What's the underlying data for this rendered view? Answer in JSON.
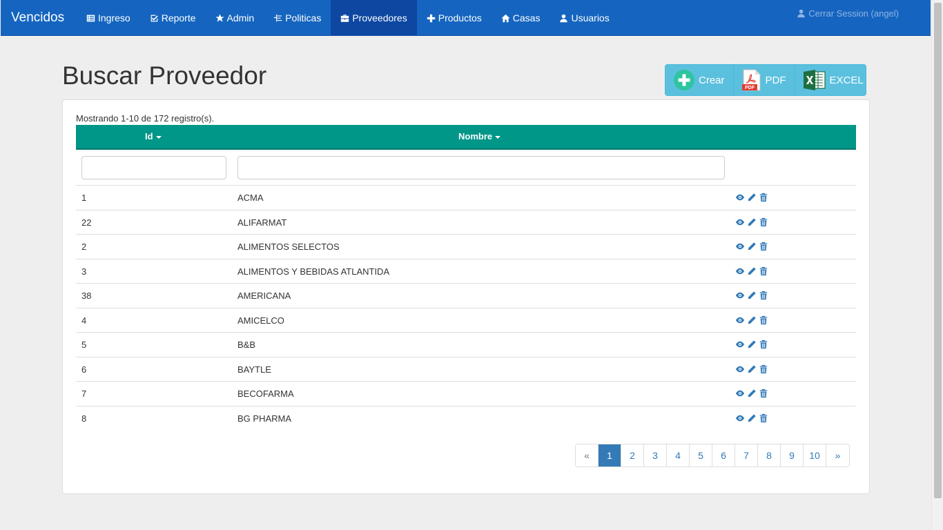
{
  "brand": "Vencidos",
  "nav": [
    {
      "label": "Ingreso",
      "icon": "list-alt-icon"
    },
    {
      "label": "Reporte",
      "icon": "check-square-icon"
    },
    {
      "label": "Admin",
      "icon": "star-icon"
    },
    {
      "label": "Politicas",
      "icon": "tree-icon"
    },
    {
      "label": "Proveedores",
      "icon": "briefcase-icon",
      "active": true
    },
    {
      "label": "Productos",
      "icon": "plus-icon"
    },
    {
      "label": "Casas",
      "icon": "home-icon"
    },
    {
      "label": "Usuarios",
      "icon": "user-icon"
    }
  ],
  "logout": "Cerrar Session (angel)",
  "page_title": "Buscar Proveedor",
  "actions": {
    "create": "Crear",
    "pdf": "PDF",
    "excel": "EXCEL"
  },
  "summary": "Mostrando 1-10 de 172 registro(s).",
  "table": {
    "columns": [
      "Id",
      "Nombre"
    ],
    "rows": [
      {
        "id": "1",
        "name": "ACMA"
      },
      {
        "id": "22",
        "name": "ALIFARMAT"
      },
      {
        "id": "2",
        "name": "ALIMENTOS SELECTOS"
      },
      {
        "id": "3",
        "name": "ALIMENTOS Y BEBIDAS ATLANTIDA"
      },
      {
        "id": "38",
        "name": "AMERICANA"
      },
      {
        "id": "4",
        "name": "AMICELCO"
      },
      {
        "id": "5",
        "name": "B&B"
      },
      {
        "id": "6",
        "name": "BAYTLE"
      },
      {
        "id": "7",
        "name": "BECOFARMA"
      },
      {
        "id": "8",
        "name": "BG PHARMA"
      }
    ]
  },
  "pagination": {
    "prev": "«",
    "pages": [
      "1",
      "2",
      "3",
      "4",
      "5",
      "6",
      "7",
      "8",
      "9",
      "10"
    ],
    "next": "»",
    "active": "1"
  },
  "colors": {
    "navbar": "#1565c0",
    "header": "#009688",
    "accent": "#337ab7",
    "actions": "#5bc0de"
  }
}
